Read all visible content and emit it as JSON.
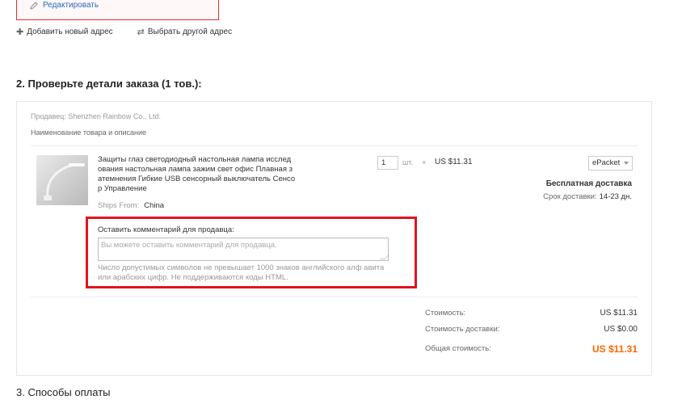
{
  "address": {
    "edit_label": "Редактировать",
    "add_new_label": "Добавить новый адрес",
    "choose_other_label": "Выбрать другой адрес"
  },
  "section2_title": "2. Проверьте детали заказа (1 тов.):",
  "order": {
    "seller": "Продавец: Shenzhen Rainbow Co., Ltd.",
    "product_header": "Наименование товара и описание",
    "product_name": "Защиты глаз светодиодный настольная лампа исслед ования настольная лампа зажим свет офис Плавная з атемнения Гибкие USB сенсорный выключатель Сенсо р Управление",
    "ships_from_label": "Ships From:",
    "ships_from_value": "China",
    "quantity": "1",
    "unit": "шт.",
    "times": "×",
    "unit_price": "US $11.31",
    "shipping_method": "ePacket",
    "free_shipping": "Бесплатная доставка",
    "delivery_label": "Срок доставки:",
    "delivery_value": "14-23 дн."
  },
  "comment": {
    "label": "Оставить комментарий для продавца:",
    "placeholder": "Вы можете оставить комментарий для продавца.",
    "hint": "Число допустимых символов не превышает 1000 знаков английского алф авита или арабских цифр. Не поддерживаются коды HTML."
  },
  "summary": {
    "cost_label": "Стоимость:",
    "cost_value": "US $11.31",
    "shipping_label": "Стоимость доставки:",
    "shipping_value": "US $0.00",
    "total_label": "Общая стоимость:",
    "total_value": "US $11.31"
  },
  "section3_title": "3. Способы оплаты",
  "colors": {
    "highlight_border": "#e3131f",
    "total_price": "#ff6600",
    "link": "#2a6bc2"
  }
}
